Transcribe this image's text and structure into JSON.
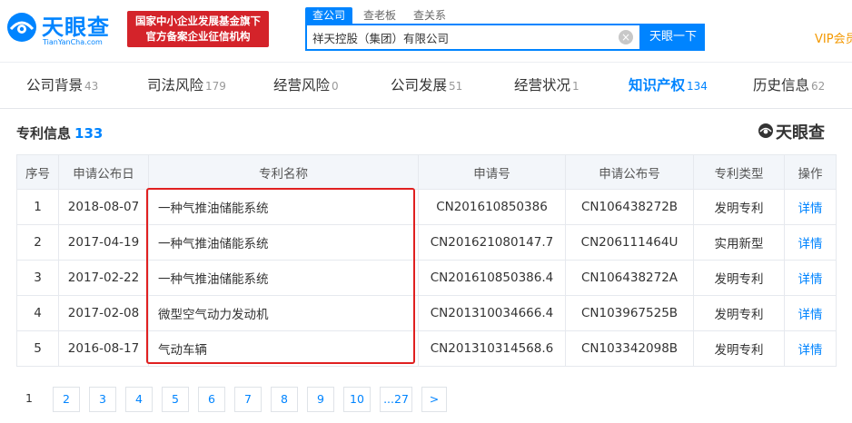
{
  "header": {
    "logo_text": "天眼查",
    "logo_sub": "TianYanCha.com",
    "slogan_line1": "国家中小企业发展基金旗下",
    "slogan_line2": "官方备案企业征信机构",
    "search_tabs": [
      "查公司",
      "查老板",
      "查关系"
    ],
    "search_value": "祥天控股（集团）有限公司",
    "clear_glyph": "×",
    "search_button": "天眼一下",
    "vip_label": "VIP会员"
  },
  "nav": {
    "items": [
      {
        "label": "公司背景",
        "count": "43"
      },
      {
        "label": "司法风险",
        "count": "179"
      },
      {
        "label": "经营风险",
        "count": "0"
      },
      {
        "label": "公司发展",
        "count": "51"
      },
      {
        "label": "经营状况",
        "count": "1"
      },
      {
        "label": "知识产权",
        "count": "134"
      },
      {
        "label": "历史信息",
        "count": "62"
      }
    ],
    "active_index": 5
  },
  "section": {
    "title": "专利信息",
    "count": "133",
    "watermark": "天眼查"
  },
  "table": {
    "headers": [
      "序号",
      "申请公布日",
      "专利名称",
      "申请号",
      "申请公布号",
      "专利类型",
      "操作"
    ],
    "rows": [
      {
        "no": "1",
        "date": "2018-08-07",
        "name": "一种气推油储能系统",
        "app_no": "CN201610850386",
        "pub_no": "CN106438272B",
        "type": "发明专利",
        "action": "详情"
      },
      {
        "no": "2",
        "date": "2017-04-19",
        "name": "一种气推油储能系统",
        "app_no": "CN201621080147.7",
        "pub_no": "CN206111464U",
        "type": "实用新型",
        "action": "详情"
      },
      {
        "no": "3",
        "date": "2017-02-22",
        "name": "一种气推油储能系统",
        "app_no": "CN201610850386.4",
        "pub_no": "CN106438272A",
        "type": "发明专利",
        "action": "详情"
      },
      {
        "no": "4",
        "date": "2017-02-08",
        "name": "微型空气动力发动机",
        "app_no": "CN201310034666.4",
        "pub_no": "CN103967525B",
        "type": "发明专利",
        "action": "详情"
      },
      {
        "no": "5",
        "date": "2016-08-17",
        "name": "气动车辆",
        "app_no": "CN201310314568.6",
        "pub_no": "CN103342098B",
        "type": "发明专利",
        "action": "详情"
      }
    ]
  },
  "pager": {
    "pages": [
      "1",
      "2",
      "3",
      "4",
      "5",
      "6",
      "7",
      "8",
      "9",
      "10",
      "...27",
      ">"
    ],
    "current": "1"
  },
  "colors": {
    "brand_blue": "#0084ff",
    "slogan_red": "#d4232a",
    "highlight_red": "#e02020",
    "vip_orange": "#f39800"
  }
}
